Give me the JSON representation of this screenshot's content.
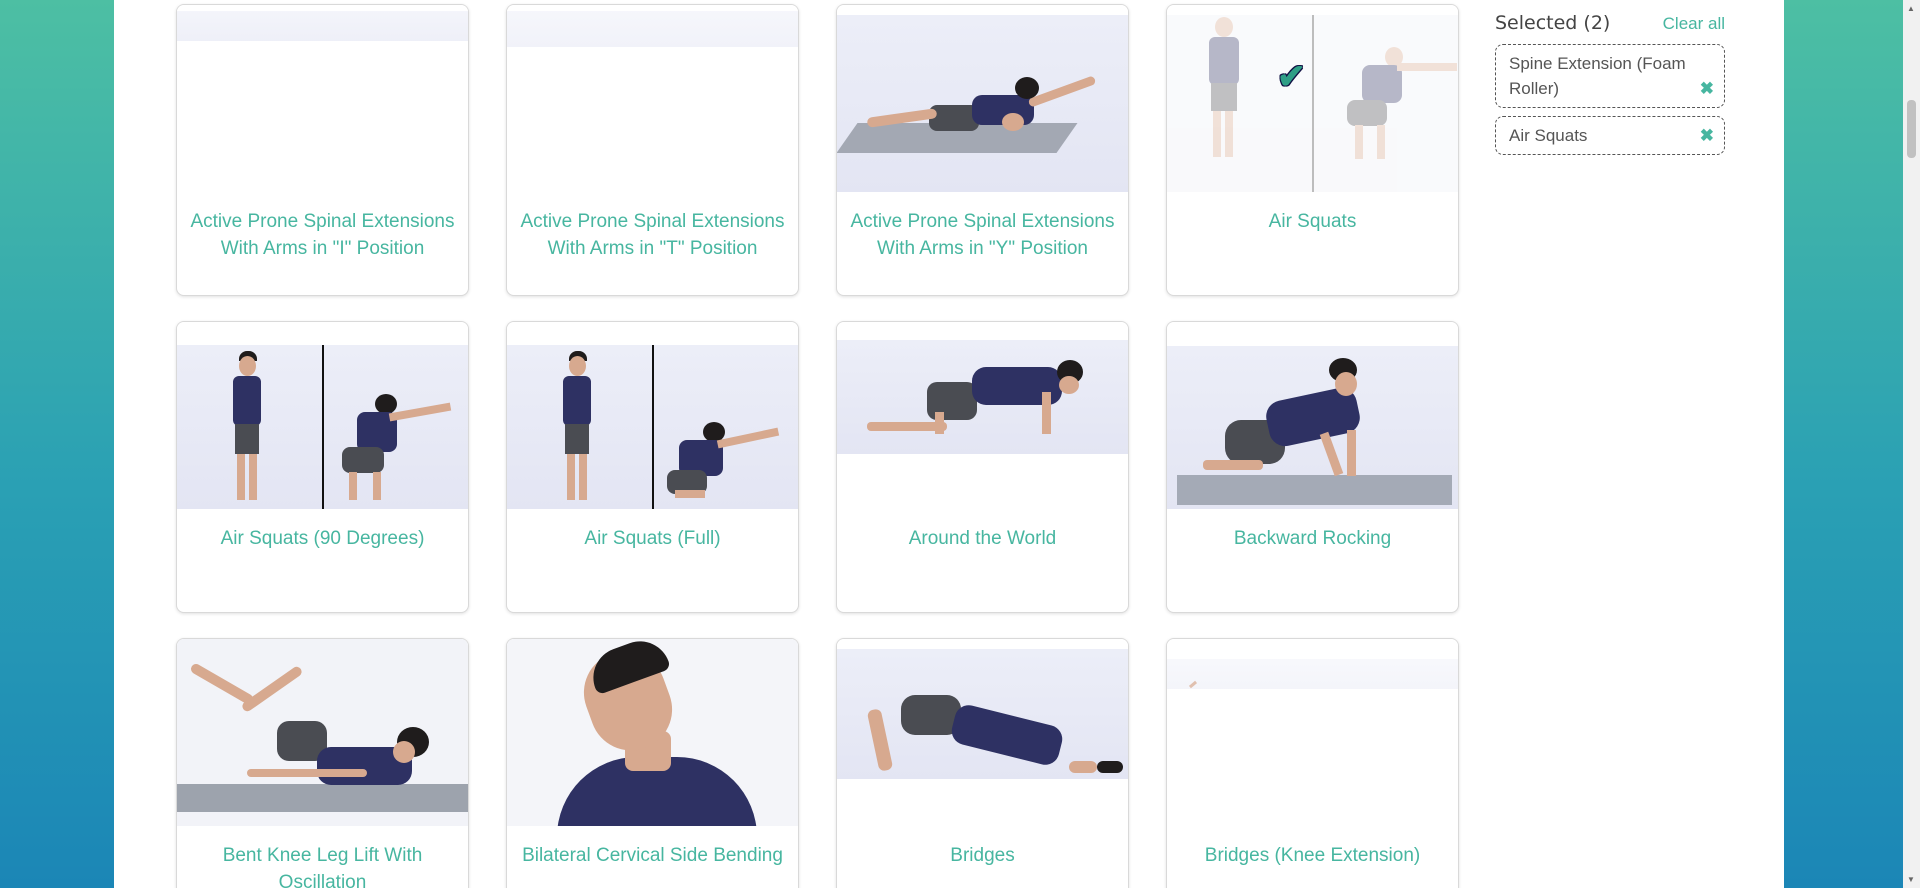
{
  "sidebar": {
    "title": "Selected (2)",
    "clear_label": "Clear all",
    "remove_icon": "close-icon",
    "selected": [
      {
        "label": "Spine Extension (Foam Roller)"
      },
      {
        "label": "Air Squats"
      }
    ]
  },
  "grid": {
    "cards": [
      {
        "title": "Active Prone Spinal Extensions With Arms in \"I\" Position",
        "selected": false
      },
      {
        "title": "Active Prone Spinal Extensions With Arms in \"T\" Position",
        "selected": false
      },
      {
        "title": "Active Prone Spinal Extensions With Arms in \"Y\" Position",
        "selected": false
      },
      {
        "title": "Air Squats",
        "selected": true
      },
      {
        "title": "Air Squats (90 Degrees)",
        "selected": false
      },
      {
        "title": "Air Squats (Full)",
        "selected": false
      },
      {
        "title": "Around the World",
        "selected": false
      },
      {
        "title": "Backward Rocking",
        "selected": false
      },
      {
        "title": "Bent Knee Leg Lift With Oscillation",
        "selected": false
      },
      {
        "title": "Bilateral Cervical Side Bending",
        "selected": false
      },
      {
        "title": "Bridges",
        "selected": false
      },
      {
        "title": "Bridges (Knee Extension)",
        "selected": false
      }
    ]
  },
  "colors": {
    "accent": "#47b6a0",
    "page_gradient_top": "#4dbfa3",
    "page_gradient_bottom": "#1b86b6"
  }
}
